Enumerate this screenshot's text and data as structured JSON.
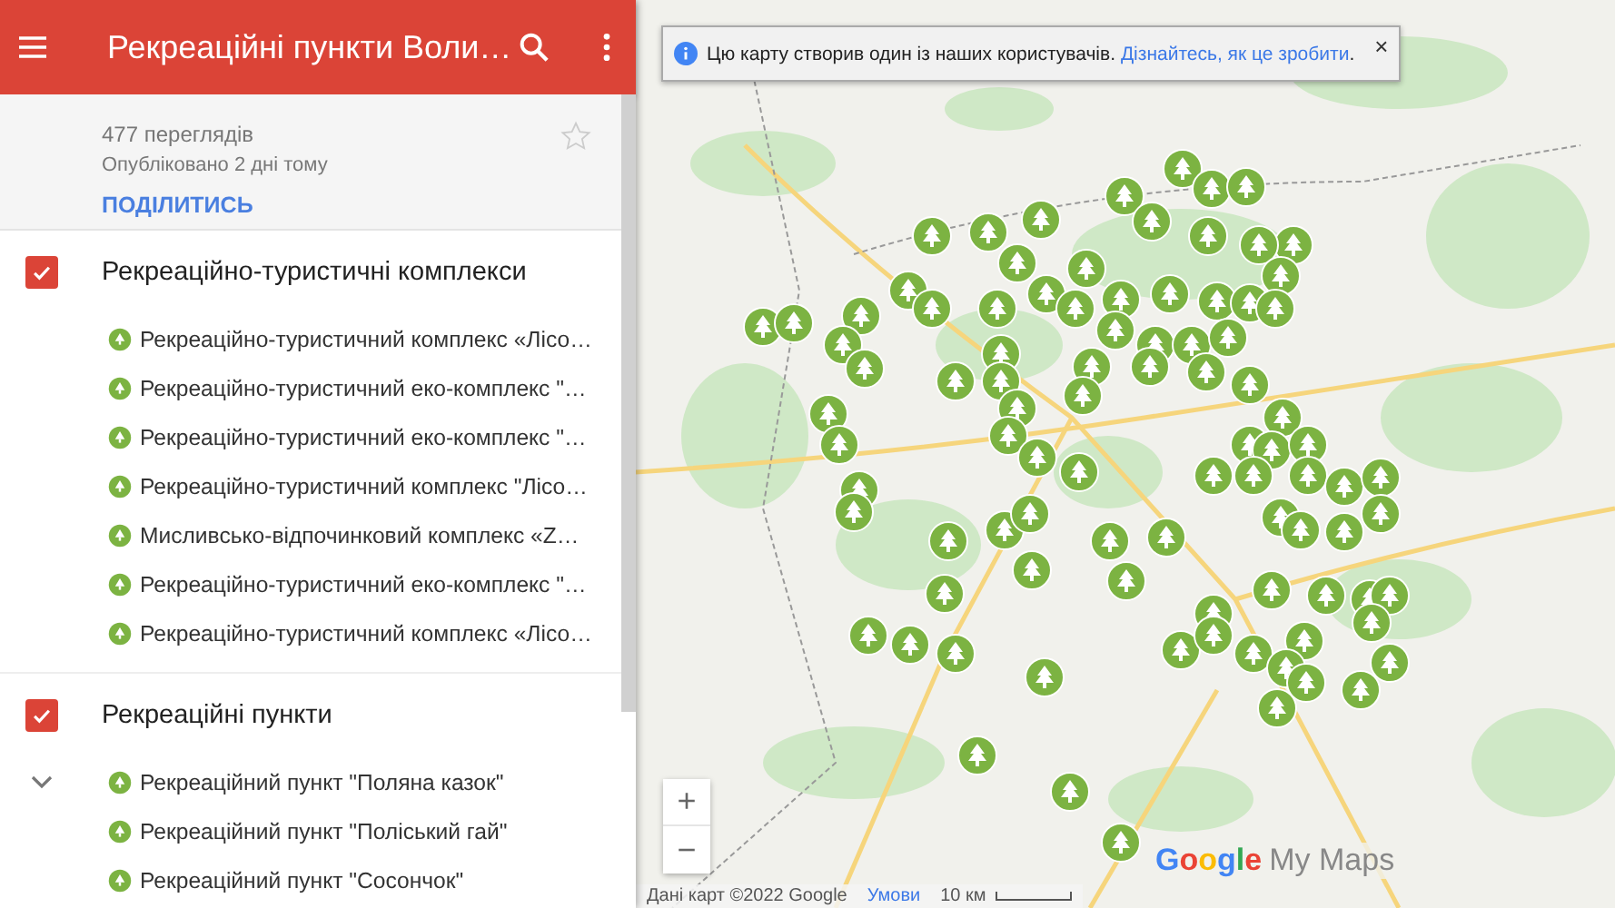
{
  "header": {
    "title": "Рекреаційні пункти Воли…"
  },
  "map_info": {
    "views": "477 переглядів",
    "published": "Опубліковано 2 дні тому",
    "share": "ПОДІЛИТИСЬ",
    "starred": false
  },
  "layers": [
    {
      "title": "Рекреаційно-туристичні комплекси",
      "checked": true,
      "toggle_shown": false,
      "items": [
        {
          "label": "Рекреаційно-туристичний комплекс «Лісо…"
        },
        {
          "label": "Рекреаційно-туристичний еко-комплекс \"…"
        },
        {
          "label": "Рекреаційно-туристичний еко-комплекс \"…"
        },
        {
          "label": "Рекреаційно-туристичний комплекс \"Лісо…"
        },
        {
          "label": "Мисливсько-відпочинковий комплекс «Z…"
        },
        {
          "label": "Рекреаційно-туристичний еко-комплекс \"…"
        },
        {
          "label": "Рекреаційно-туристичний комплекс «Лісо…"
        }
      ]
    },
    {
      "title": "Рекреаційні пункти",
      "checked": true,
      "toggle_shown": true,
      "items": [
        {
          "label": "Рекреаційний пункт \"Поляна казок\""
        },
        {
          "label": "Рекреаційний пункт \"Поліський гай\""
        },
        {
          "label": "Рекреаційний пункт \"Сосончок\""
        }
      ]
    }
  ],
  "notice": {
    "text": "Цю карту створив один із наших користувачів. ",
    "link": "Дізнайтесь, як це зробити",
    "end": ".",
    "close": "×"
  },
  "zoom": {
    "in": "+",
    "out": "−"
  },
  "logo": {
    "brand": "Google",
    "product": "My Maps"
  },
  "attribution": {
    "data": "Дані карт ©2022 Google",
    "terms": "Умови",
    "scale": "10 км"
  }
}
